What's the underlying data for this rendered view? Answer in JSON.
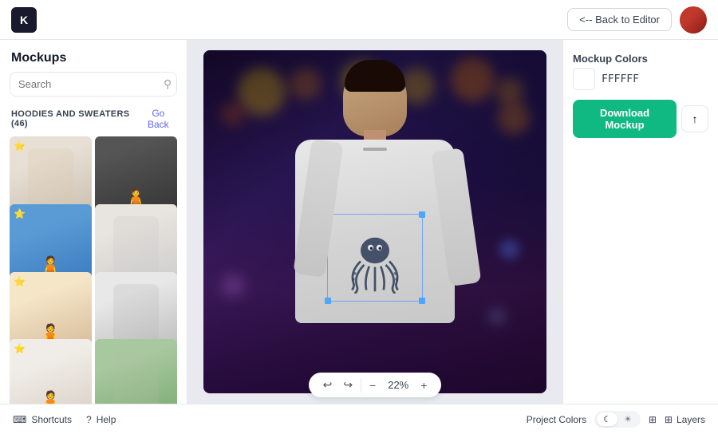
{
  "topbar": {
    "logo_text": "K",
    "back_button_label": "<-- Back to Editor"
  },
  "sidebar": {
    "title": "Mockups",
    "search_placeholder": "Search",
    "category_label": "HOODIES AND SWEATERS (46)",
    "go_back_label": "Go Back",
    "thumbs": [
      {
        "id": 1,
        "star": true,
        "class": "thumb-1",
        "type": "object"
      },
      {
        "id": 2,
        "star": false,
        "class": "thumb-2",
        "type": "person"
      },
      {
        "id": 3,
        "star": true,
        "class": "thumb-3",
        "type": "person"
      },
      {
        "id": 4,
        "star": false,
        "class": "thumb-4",
        "type": "object"
      },
      {
        "id": 5,
        "star": true,
        "class": "thumb-5",
        "type": "person"
      },
      {
        "id": 6,
        "star": false,
        "class": "thumb-6",
        "type": "object"
      },
      {
        "id": 7,
        "star": true,
        "class": "thumb-7",
        "type": "person"
      },
      {
        "id": 8,
        "star": false,
        "class": "thumb-8",
        "type": "object"
      },
      {
        "id": 9,
        "star": false,
        "class": "thumb-9",
        "type": "object"
      }
    ]
  },
  "canvas": {
    "zoom_value": "22%",
    "toolbar": {
      "undo": "↩",
      "redo": "↪",
      "zoom_out": "−",
      "zoom_in": "+"
    }
  },
  "right_panel": {
    "section_title": "Mockup Colors",
    "color_value": "FFFFFF",
    "download_label": "Download Mockup",
    "share_icon": "↑"
  },
  "bottombar": {
    "shortcuts_label": "Shortcuts",
    "help_label": "Help",
    "project_colors_label": "Project Colors",
    "toggle_options": [
      "☾",
      "☀"
    ],
    "layers_label": "Layers"
  }
}
